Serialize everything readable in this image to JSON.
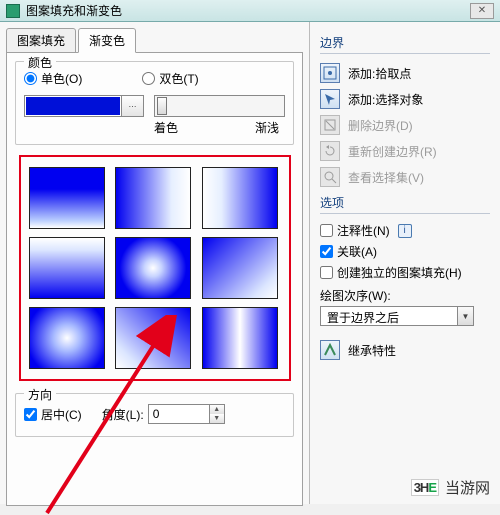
{
  "window": {
    "title": "图案填充和渐变色"
  },
  "tabs": {
    "pattern": "图案填充",
    "gradient": "渐变色"
  },
  "color_group": {
    "legend": "颜色",
    "single_label": "单色(O)",
    "double_label": "双色(T)",
    "swatch_hex": "#0010d8",
    "slider_left": "着色",
    "slider_right": "渐浅"
  },
  "direction_group": {
    "legend": "方向",
    "center_label": "居中(C)",
    "center_checked": true,
    "angle_label": "角度(L):",
    "angle_value": "0"
  },
  "boundary": {
    "title": "边界",
    "add_pick": "添加:拾取点",
    "add_select": "添加:选择对象",
    "delete": "删除边界(D)",
    "recreate": "重新创建边界(R)",
    "view_sel": "查看选择集(V)"
  },
  "options": {
    "title": "选项",
    "annotative": "注释性(N)",
    "assoc": "关联(A)",
    "independent": "创建独立的图案填充(H)",
    "draw_order_label": "绘图次序(W):",
    "draw_order_value": "置于边界之后"
  },
  "inherit": {
    "label": "继承特性"
  },
  "watermark": {
    "site": "当游网"
  }
}
